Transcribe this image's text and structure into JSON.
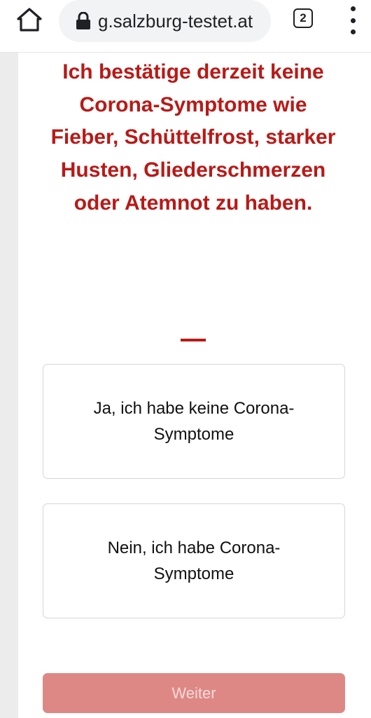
{
  "browser": {
    "url": "g.salzburg-testet.at",
    "tab_count": "2",
    "icons": {
      "home": "home-icon",
      "lock": "lock-icon",
      "tabs": "tab-switcher-icon",
      "menu": "more-vert-icon"
    }
  },
  "form": {
    "question": "Ich bestätige derzeit keine Corona-Symptome wie Fieber, Schüttelfrost, starker Husten, Gliederschmerzen oder Atemnot zu haben.",
    "options": [
      {
        "label": "Ja, ich habe keine Corona-Symptome"
      },
      {
        "label": "Nein, ich habe Corona-Symptome"
      }
    ],
    "submit_label": "Weiter",
    "submit_enabled": false
  },
  "colors": {
    "accent": "#b81a17",
    "submit_disabled_bg": "#de8885",
    "submit_disabled_text": "#f7dada",
    "option_border": "#d6d6d6"
  }
}
